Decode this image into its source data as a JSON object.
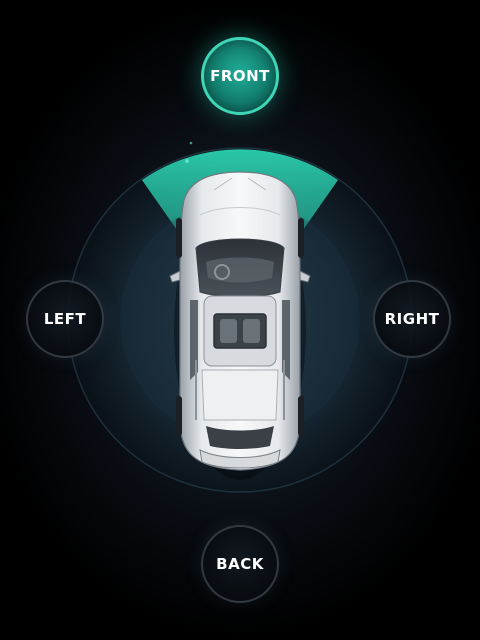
{
  "controls": {
    "front": {
      "label": "FRONT",
      "active": true
    },
    "left": {
      "label": "LEFT",
      "active": false
    },
    "right": {
      "label": "RIGHT",
      "active": false
    },
    "back": {
      "label": "BACK",
      "active": false
    }
  },
  "colors": {
    "accent": "#3fd6b6",
    "accent_dark": "#0f6f62",
    "background": "#000000",
    "car_body": "#e8ebef"
  },
  "camera_view": "front"
}
